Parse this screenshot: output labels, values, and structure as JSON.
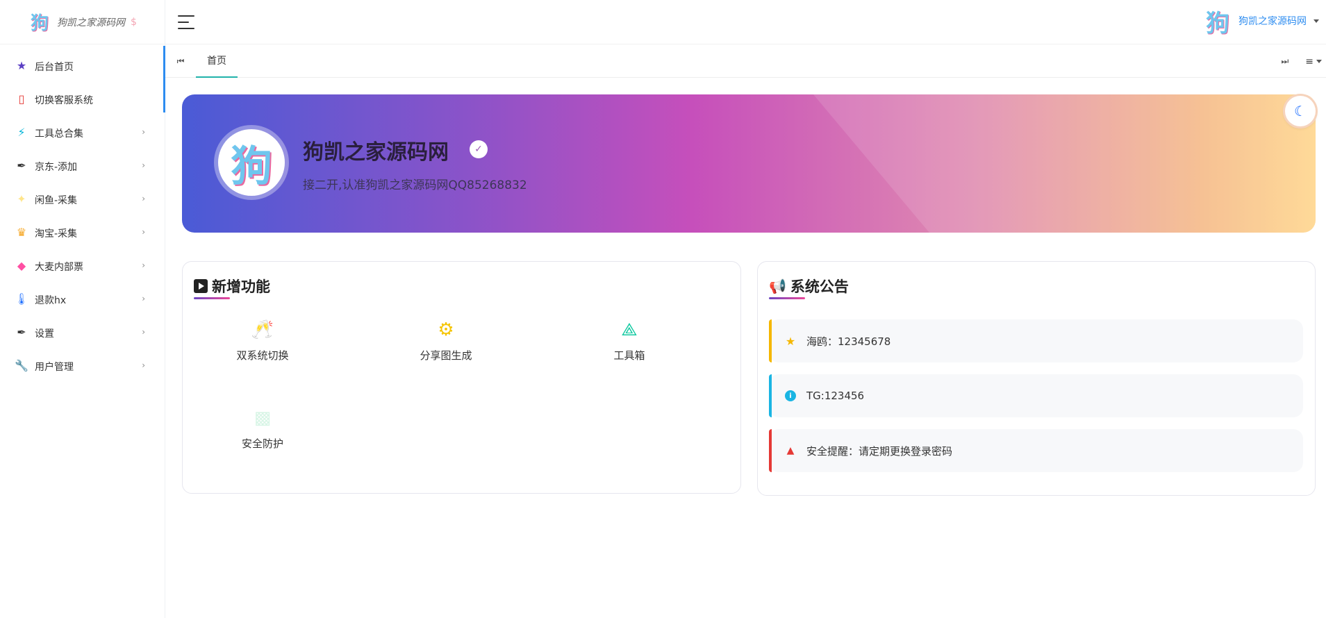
{
  "sidebar": {
    "logo_glyph": "狗",
    "logo_text": "狗凯之家源码网",
    "logo_symbol": "$",
    "items": [
      {
        "label": "后台首页",
        "icon": "star-icon",
        "glyph": "★",
        "color": "#5b3fc4",
        "has_children": false
      },
      {
        "label": "切换客服系统",
        "icon": "broken-image-icon",
        "glyph": "▯",
        "color": "#e53935",
        "has_children": false
      },
      {
        "label": "工具总合集",
        "icon": "lightning-icon",
        "glyph": "⚡",
        "color": "#00b4d8",
        "has_children": true
      },
      {
        "label": "京东-添加",
        "icon": "pen-icon",
        "glyph": "✒",
        "color": "#333333",
        "has_children": true
      },
      {
        "label": "闲鱼-采集",
        "icon": "sparkle-icon",
        "glyph": "✦",
        "color": "#ffe58a",
        "has_children": true
      },
      {
        "label": "淘宝-采集",
        "icon": "crown-icon",
        "glyph": "♛",
        "color": "#f5a623",
        "has_children": true
      },
      {
        "label": "大麦内部票",
        "icon": "gem-icon",
        "glyph": "◆",
        "color": "#ff4fa3",
        "has_children": true
      },
      {
        "label": "退款hx",
        "icon": "thermometer-icon",
        "glyph": "🌡",
        "color": "#1e6fff",
        "has_children": true
      },
      {
        "label": "设置",
        "icon": "pen-icon",
        "glyph": "✒",
        "color": "#333333",
        "has_children": true
      },
      {
        "label": "用户管理",
        "icon": "wrench-icon",
        "glyph": "🔧",
        "color": "#555555",
        "has_children": true
      }
    ]
  },
  "header": {
    "user_name": "狗凯之家源码网",
    "user_glyph": "狗"
  },
  "tabs": [
    {
      "label": "首页",
      "active": true
    }
  ],
  "banner": {
    "avatar_glyph": "狗",
    "title": "狗凯之家源码网",
    "subtitle": "接二开,认准狗凯之家源码网QQ85268832"
  },
  "features": {
    "title": "新增功能",
    "items": [
      {
        "label": "双系统切换",
        "icon": "toast-glasses-icon",
        "glyph": "🥂",
        "color": "#ff9fb2"
      },
      {
        "label": "分享图生成",
        "icon": "gears-icon",
        "glyph": "⚙",
        "color": "#f5c400"
      },
      {
        "label": "工具箱",
        "icon": "compass-icon",
        "glyph": "⟁",
        "color": "#10c9a0"
      },
      {
        "label": "安全防护",
        "icon": "puzzle-icon",
        "glyph": "▩",
        "color": "#d8f5e6"
      }
    ]
  },
  "notices": {
    "title": "系统公告",
    "items": [
      {
        "text": "海鸥：12345678",
        "icon": "star-icon",
        "color": "#f5b700"
      },
      {
        "text": "TG:123456",
        "icon": "info-icon",
        "color": "#1ab5e3"
      },
      {
        "text": "安全提醒：请定期更换登录密码",
        "icon": "warning-icon",
        "color": "#e53935"
      }
    ]
  }
}
